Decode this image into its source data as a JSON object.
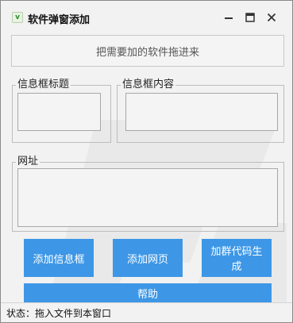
{
  "window": {
    "title": "软件弹窗添加",
    "icon": "app-icon-green-v",
    "icon_glyph": "v",
    "controls": [
      "minimize-icon",
      "maximize-icon",
      "close-icon"
    ]
  },
  "drop_zone": {
    "text": "把需要加的软件拖进来"
  },
  "groups": {
    "title_group": {
      "label": "信息框标题",
      "value": ""
    },
    "content_group": {
      "label": "信息框内容",
      "value": ""
    },
    "url_group": {
      "label": "网址",
      "value": ""
    }
  },
  "buttons": {
    "add_infobox": "添加信息框",
    "add_webpage": "添加网页",
    "group_code": "加群代码生成",
    "help": "帮助"
  },
  "status": {
    "text": "状态：拖入文件到本窗口"
  },
  "colors": {
    "accent": "#3d97e6",
    "window_bg": "#f2f2f2",
    "field_border": "#a8a8a8"
  }
}
